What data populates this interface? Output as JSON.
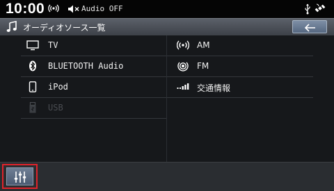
{
  "status": {
    "time": "10:00",
    "audio_status": "Audio OFF",
    "icons": [
      "signal-icon",
      "mute-icon",
      "usb-icon",
      "satellite-icon"
    ]
  },
  "header": {
    "title": "オーディオソース一覧",
    "title_icon": "music-note-icon",
    "back_icon": "back-arrow-icon"
  },
  "sources": {
    "left": [
      {
        "label": "TV",
        "icon": "tv-icon",
        "enabled": true
      },
      {
        "label": "BLUETOOTH Audio",
        "icon": "bluetooth-icon",
        "enabled": true
      },
      {
        "label": "iPod",
        "icon": "ipod-icon",
        "enabled": true
      },
      {
        "label": "USB",
        "icon": "usb-icon",
        "enabled": false
      }
    ],
    "right": [
      {
        "label": "AM",
        "icon": "am-radio-icon",
        "enabled": true
      },
      {
        "label": "FM",
        "icon": "fm-radio-icon",
        "enabled": true
      },
      {
        "label": "交通情報",
        "icon": "traffic-info-icon",
        "enabled": true
      }
    ]
  },
  "footer": {
    "eq_icon": "equalizer-icon"
  },
  "colors": {
    "title_bar": "#4a4f57",
    "button_blue": "#6b7c93",
    "highlight": "#e0232b",
    "background": "#16181b"
  }
}
